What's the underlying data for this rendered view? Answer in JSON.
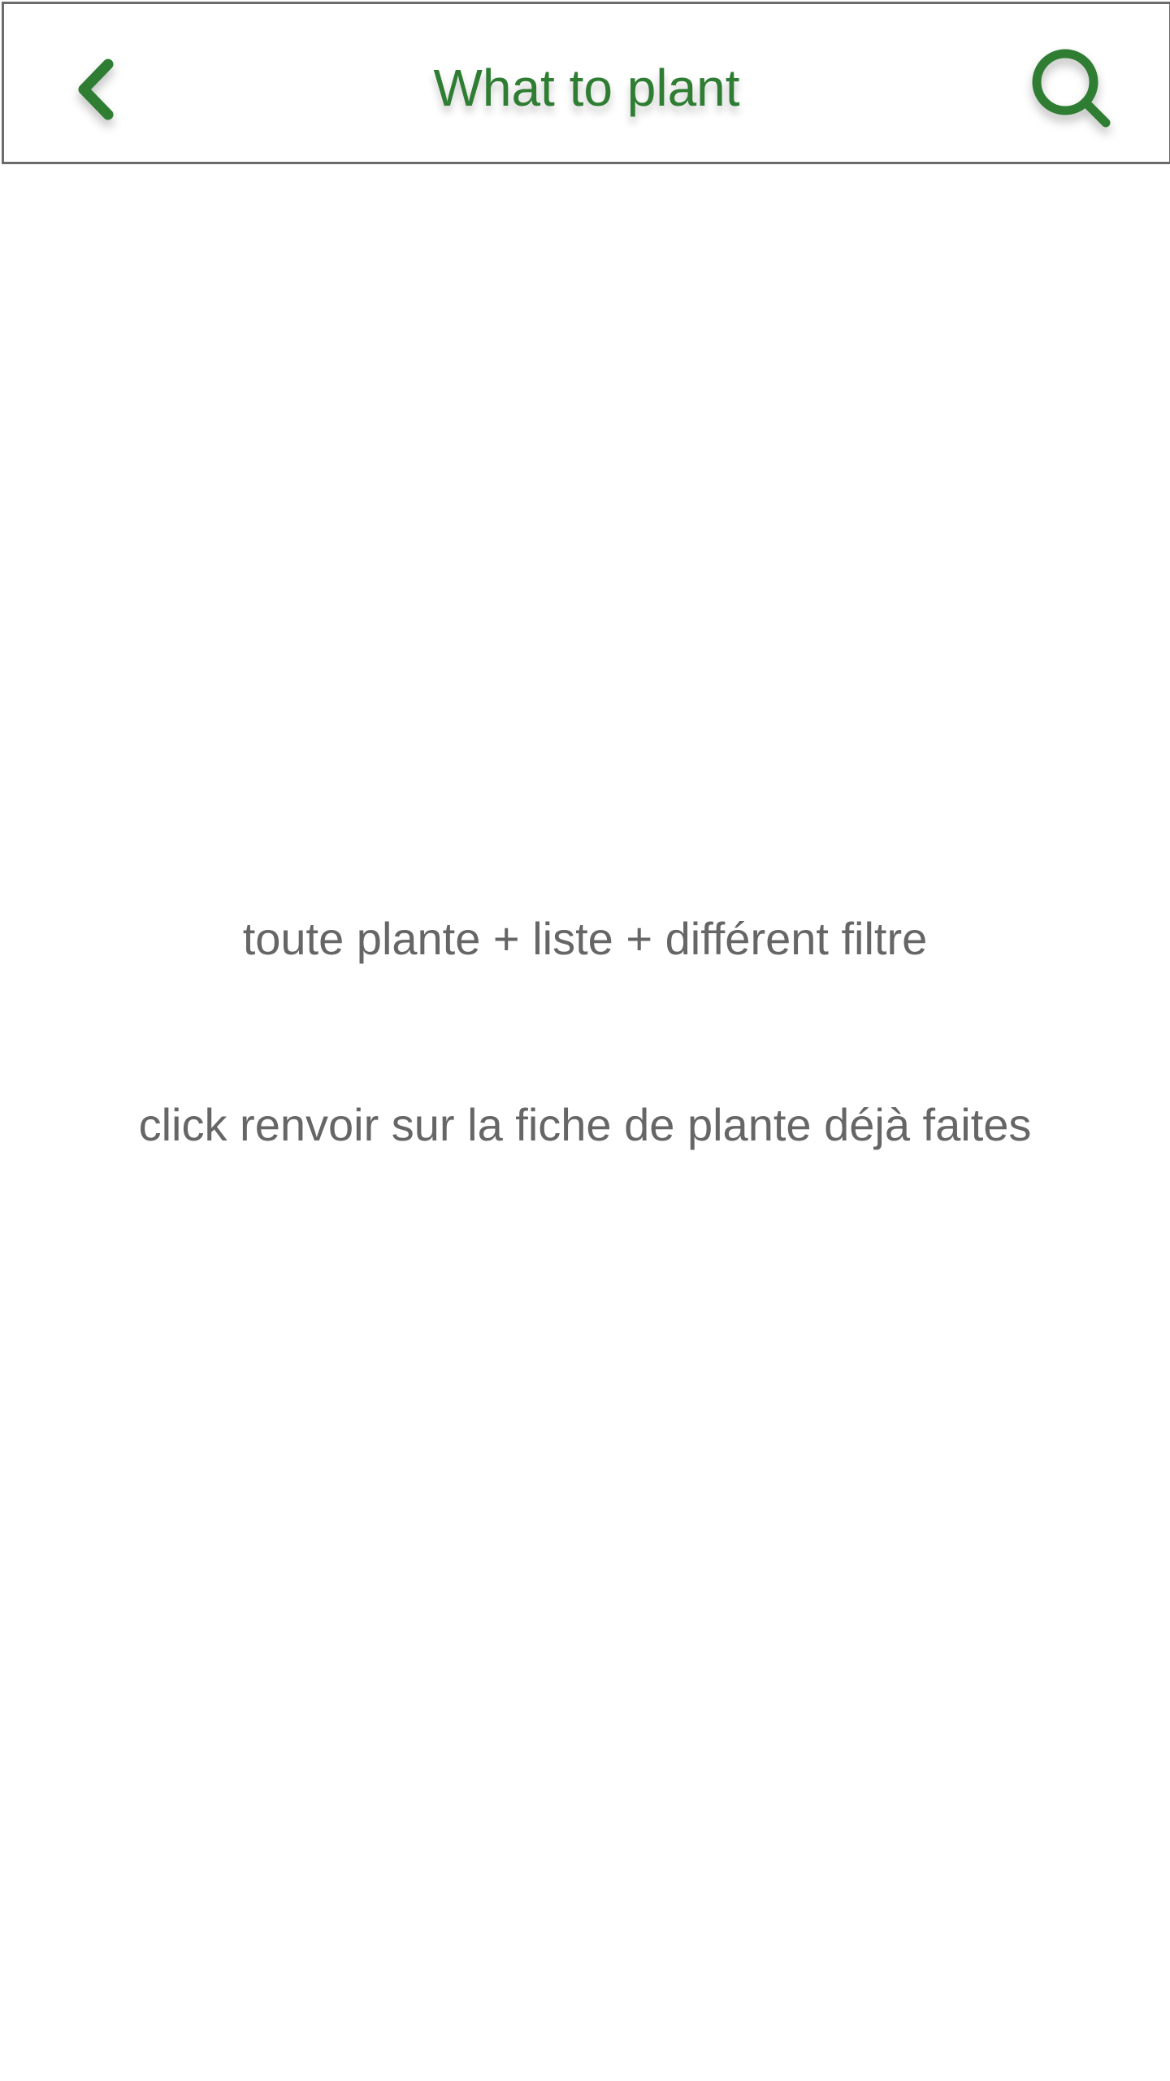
{
  "header": {
    "title": "What to plant",
    "back_icon": "chevron-left-icon",
    "search_icon": "search-icon",
    "accent_color": "#2e7d32",
    "border_color": "#6b6b6b"
  },
  "main": {
    "lines": [
      "toute plante + liste + différent filtre",
      "click renvoir sur la fiche de plante déjà faites"
    ],
    "text_color": "#666666"
  }
}
